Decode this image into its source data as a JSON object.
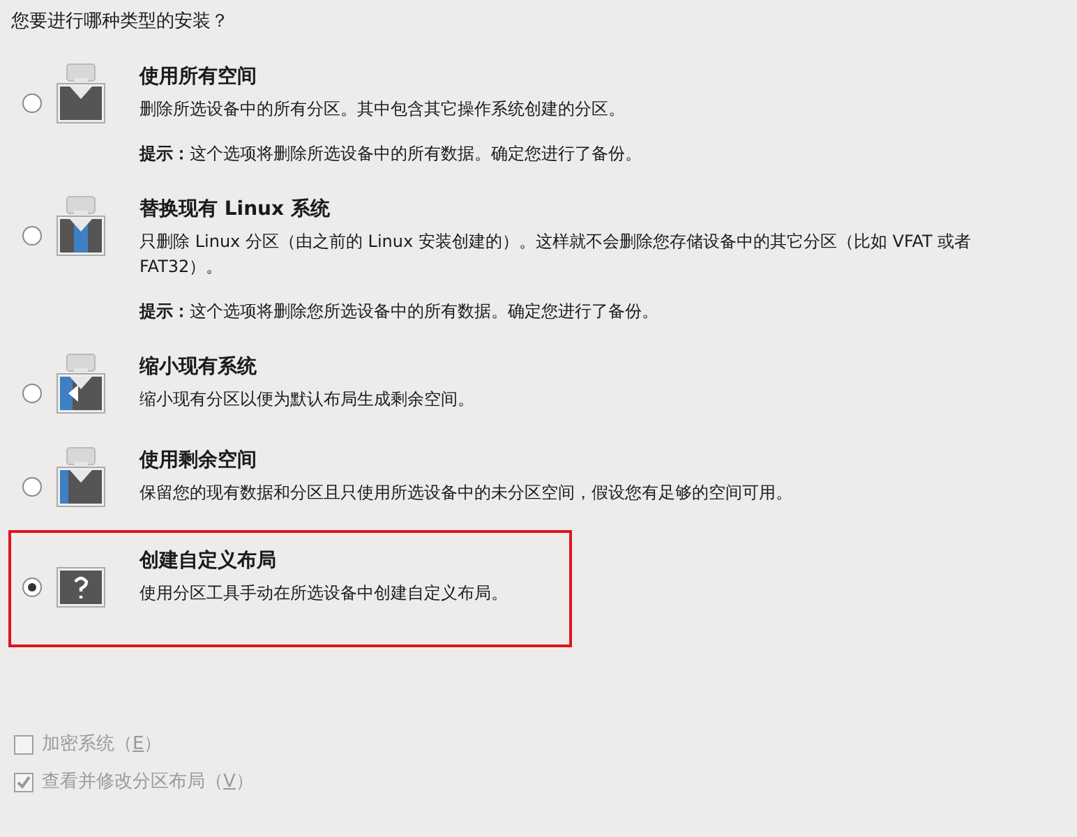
{
  "question": "您要进行哪种类型的安装？",
  "options": [
    {
      "kind": "all",
      "title": "使用所有空间",
      "description": "删除所选设备中的所有分区。其中包含其它操作系统创建的分区。",
      "hint": "**提示：**这个选项将删除所选设备中的所有数据。确定您进行了备份。",
      "selected": false,
      "highlighted": false
    },
    {
      "kind": "replace",
      "title": "替换现有 Linux 系统",
      "description": "只删除 Linux 分区（由之前的 Linux 安装创建的）。这样就不会删除您存储设备中的其它分区（比如 VFAT 或者 FAT32）。",
      "hint": "**提示：**这个选项将删除您所选设备中的所有数据。确定您进行了备份。",
      "selected": false,
      "highlighted": false
    },
    {
      "kind": "shrink",
      "title": "缩小现有系统",
      "description": "缩小现有分区以便为默认布局生成剩余空间。",
      "selected": false,
      "highlighted": false
    },
    {
      "kind": "free",
      "title": "使用剩余空间",
      "description": "保留您的现有数据和分区且只使用所选设备中的未分区空间，假设您有足够的空间可用。",
      "selected": false,
      "highlighted": false
    },
    {
      "kind": "custom",
      "title": "创建自定义布局",
      "description": "使用分区工具手动在所选设备中创建自定义布局。",
      "selected": true,
      "highlighted": true
    }
  ],
  "checkboxes": [
    {
      "label_before": "加密系统（",
      "mnemonic": "E",
      "label_after": "）",
      "checked": false,
      "disabled": true
    },
    {
      "label_before": "查看并修改分区布局（",
      "mnemonic": "V",
      "label_after": "）",
      "checked": true,
      "disabled": true
    }
  ]
}
